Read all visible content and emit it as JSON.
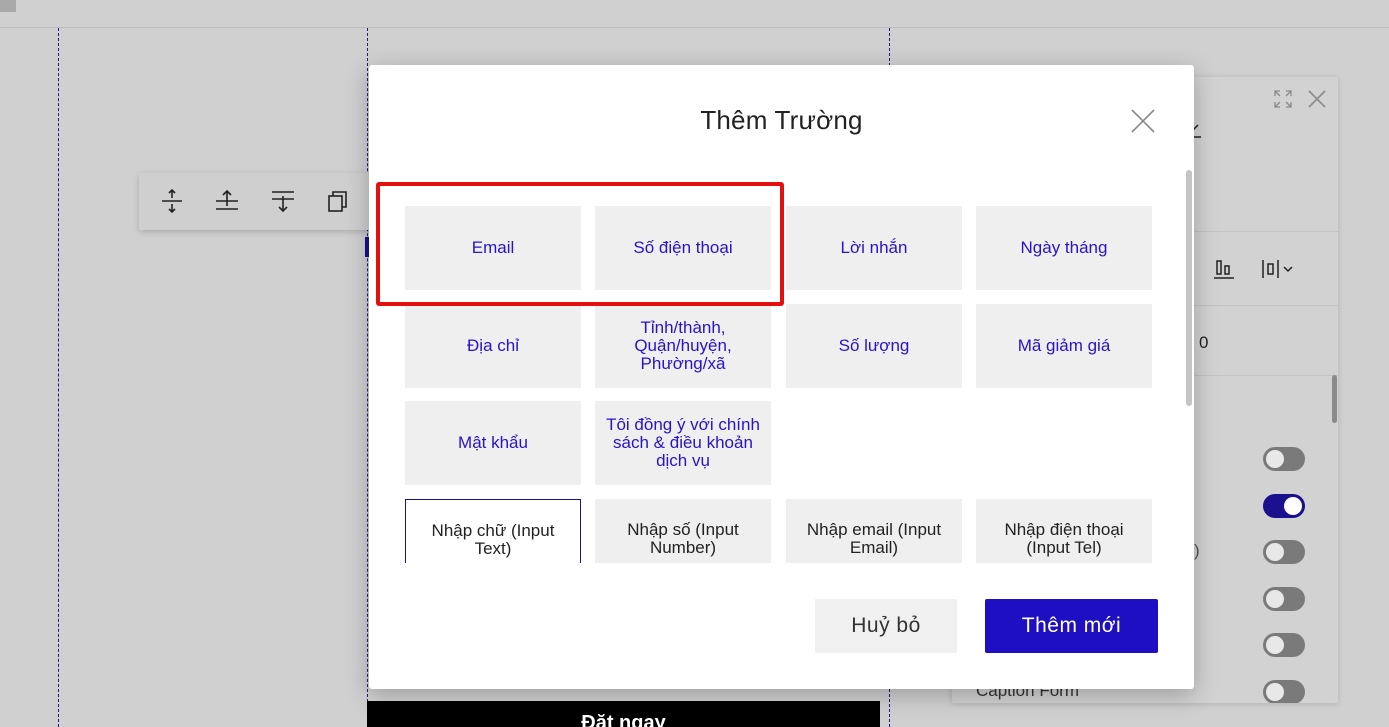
{
  "modal": {
    "title": "Thêm Trường",
    "field_types": [
      "Email",
      "Số điện thoại",
      "Lời nhắn",
      "Ngày tháng",
      "Địa chỉ",
      "Tỉnh/thành, Quận/huyện, Phường/xã",
      "Số lượng",
      "Mã giảm giá",
      "Mật khẩu",
      "Tôi đồng ý với chính sách & điều khoản dịch vụ"
    ],
    "input_types": [
      "Nhập chữ (Input Text)",
      "Nhập số (Input Number)",
      "Nhập email (Input Email)",
      "Nhập điện thoại (Input Tel)"
    ],
    "selected_input_type": "Nhập chữ (Input Text)",
    "cancel_label": "Huỷ bỏ",
    "add_label": "Thêm mới",
    "highlight_color": "#e41010",
    "accent_color": "#1e0fc3"
  },
  "background": {
    "cta_label": "Đặt ngay",
    "settings_panel": {
      "number_value": "0",
      "paren_text": ")",
      "caption_label": "Caption Form",
      "toggles": [
        false,
        true,
        false,
        false,
        false,
        false
      ]
    },
    "toolbar_icons": [
      "move-vertical-icon",
      "align-top-icon",
      "align-bottom-icon",
      "duplicate-icon"
    ]
  }
}
